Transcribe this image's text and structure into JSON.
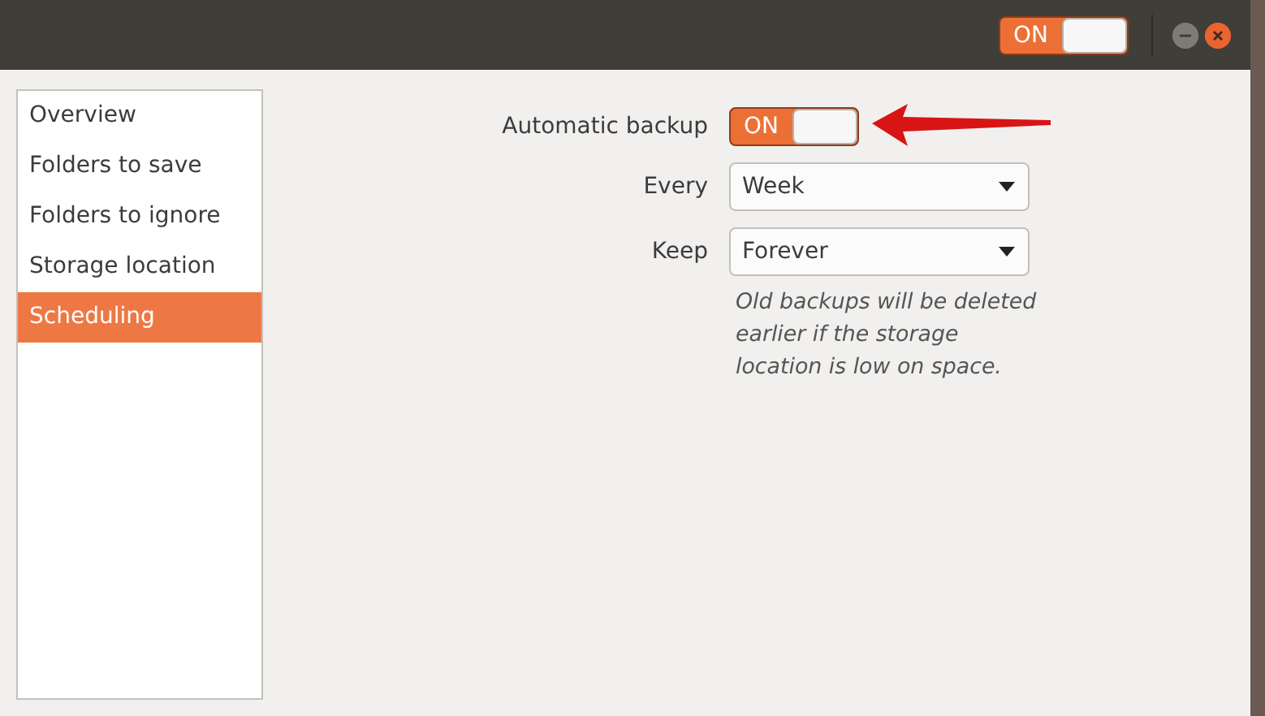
{
  "header": {
    "switch": {
      "label": "ON",
      "on": true
    }
  },
  "sidebar": {
    "items": [
      {
        "label": "Overview",
        "selected": false
      },
      {
        "label": "Folders to save",
        "selected": false
      },
      {
        "label": "Folders to ignore",
        "selected": false
      },
      {
        "label": "Storage location",
        "selected": false
      },
      {
        "label": "Scheduling",
        "selected": true
      }
    ]
  },
  "form": {
    "rows": [
      {
        "kind": "switch",
        "label": "Automatic backup",
        "value": "ON",
        "on": true
      },
      {
        "kind": "dropdown",
        "label": "Every",
        "value": "Week"
      },
      {
        "kind": "dropdown",
        "label": "Keep",
        "value": "Forever"
      }
    ],
    "hint": "Old backups will be deleted earlier if the storage location is low on space."
  }
}
